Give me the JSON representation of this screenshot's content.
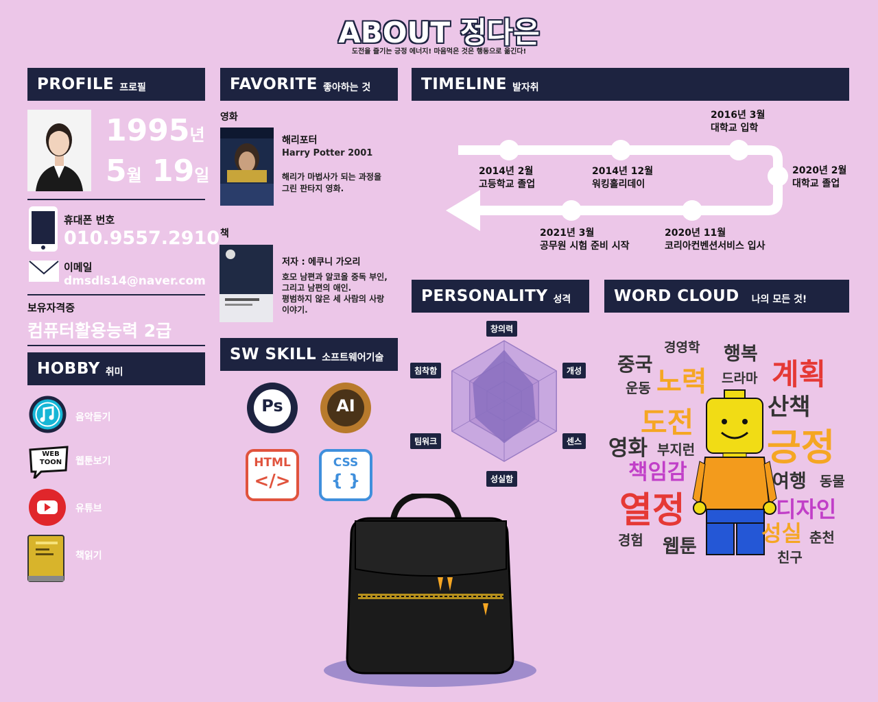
{
  "header": {
    "title": "ABOUT 정다은",
    "subtitle": "도전을 즐기는 긍정 에너지! 마음먹은 것은 행동으로 옮긴다!"
  },
  "profile": {
    "heading": "PROFILE",
    "heading_kr": "프로필",
    "birth_year": "1995",
    "birth_year_unit": "년",
    "birth_month": "5",
    "birth_month_unit": "월",
    "birth_day": "19",
    "birth_day_unit": "일",
    "phone_label": "휴대폰 번호",
    "phone": "010.9557.2910",
    "email_label": "이메일",
    "email": "dmsdls14@naver.com",
    "cert_label": "보유자격증",
    "cert": "컴퓨터활용능력 2급"
  },
  "hobby": {
    "heading": "HOBBY",
    "heading_kr": "취미",
    "items": [
      {
        "label": "음악듣기",
        "icon": "music-icon"
      },
      {
        "label": "웹툰보기",
        "icon": "webtoon-icon",
        "badge1": "WEB",
        "badge2": "TOON"
      },
      {
        "label": "유튜브",
        "icon": "youtube-icon"
      },
      {
        "label": "책읽기",
        "icon": "book-icon"
      }
    ]
  },
  "favorite": {
    "heading": "FAVORITE",
    "heading_kr": "좋아하는 것",
    "movie_label": "영화",
    "movie_title": "해리포터",
    "movie_sub": "Harry Potter 2001",
    "movie_desc1": "해리가 마법사가 되는 과정을",
    "movie_desc2": "그린 판타지 영화.",
    "book_label": "책",
    "book_author": "저자 : 에쿠니 가오리",
    "book_desc1": "호모 남편과 알코올 중독 부인,",
    "book_desc2": "그리고 남편의 애인.",
    "book_desc3": "평범하지 않은 세 사람의 사랑",
    "book_desc4": "이야기."
  },
  "skill": {
    "heading": "SW SKILL",
    "heading_kr": "소프트웨어기술",
    "items": [
      {
        "label": "Ps",
        "icon": "photoshop-icon",
        "color": "#1d2340"
      },
      {
        "label": "AI",
        "icon": "illustrator-icon",
        "color": "#b87a2c"
      },
      {
        "label": "HTML",
        "icon": "html-icon",
        "code": "</>",
        "color": "#e0533d"
      },
      {
        "label": "CSS",
        "icon": "css-icon",
        "code": "{ }",
        "color": "#3f8fdc"
      }
    ]
  },
  "timeline": {
    "heading": "TIMELINE",
    "heading_kr": "발자취",
    "events": [
      {
        "date": "2014년 2월",
        "event": "고등학교 졸업"
      },
      {
        "date": "2014년 12월",
        "event": "워킹홀리데이"
      },
      {
        "date": "2016년 3월",
        "event": "대학교 입학"
      },
      {
        "date": "2020년 2월",
        "event": "대학교 졸업"
      },
      {
        "date": "2020년 11월",
        "event": "코리아컨벤션서비스 입사"
      },
      {
        "date": "2021년 3월",
        "event": "공무원 시험 준비 시작"
      }
    ]
  },
  "personality": {
    "heading": "PERSONALITY",
    "heading_kr": "성격",
    "axes": [
      "창의력",
      "개성",
      "센스",
      "성실함",
      "팀워크",
      "침착함"
    ],
    "values": [
      0.85,
      0.55,
      0.6,
      0.7,
      0.55,
      0.6
    ]
  },
  "wordcloud": {
    "heading": "WORD CLOUD",
    "heading_kr": "나의 모든 것!",
    "words": [
      {
        "text": "중국",
        "color": "#333333"
      },
      {
        "text": "경영학",
        "color": "#333333"
      },
      {
        "text": "행복",
        "color": "#333333"
      },
      {
        "text": "계획",
        "color": "#e53935"
      },
      {
        "text": "노력",
        "color": "#f5a623"
      },
      {
        "text": "드라마",
        "color": "#333333"
      },
      {
        "text": "운동",
        "color": "#333333"
      },
      {
        "text": "산책",
        "color": "#333333"
      },
      {
        "text": "도전",
        "color": "#f5a623"
      },
      {
        "text": "긍정",
        "color": "#f5a623"
      },
      {
        "text": "영화",
        "color": "#333333"
      },
      {
        "text": "부지런",
        "color": "#333333"
      },
      {
        "text": "책임감",
        "color": "#c13fc8"
      },
      {
        "text": "여행",
        "color": "#333333"
      },
      {
        "text": "동물",
        "color": "#333333"
      },
      {
        "text": "열정",
        "color": "#e53935"
      },
      {
        "text": "디자인",
        "color": "#c13fc8"
      },
      {
        "text": "경험",
        "color": "#333333"
      },
      {
        "text": "웹툰",
        "color": "#333333"
      },
      {
        "text": "성실",
        "color": "#f5a623"
      },
      {
        "text": "춘천",
        "color": "#333333"
      },
      {
        "text": "친구",
        "color": "#333333"
      }
    ]
  }
}
